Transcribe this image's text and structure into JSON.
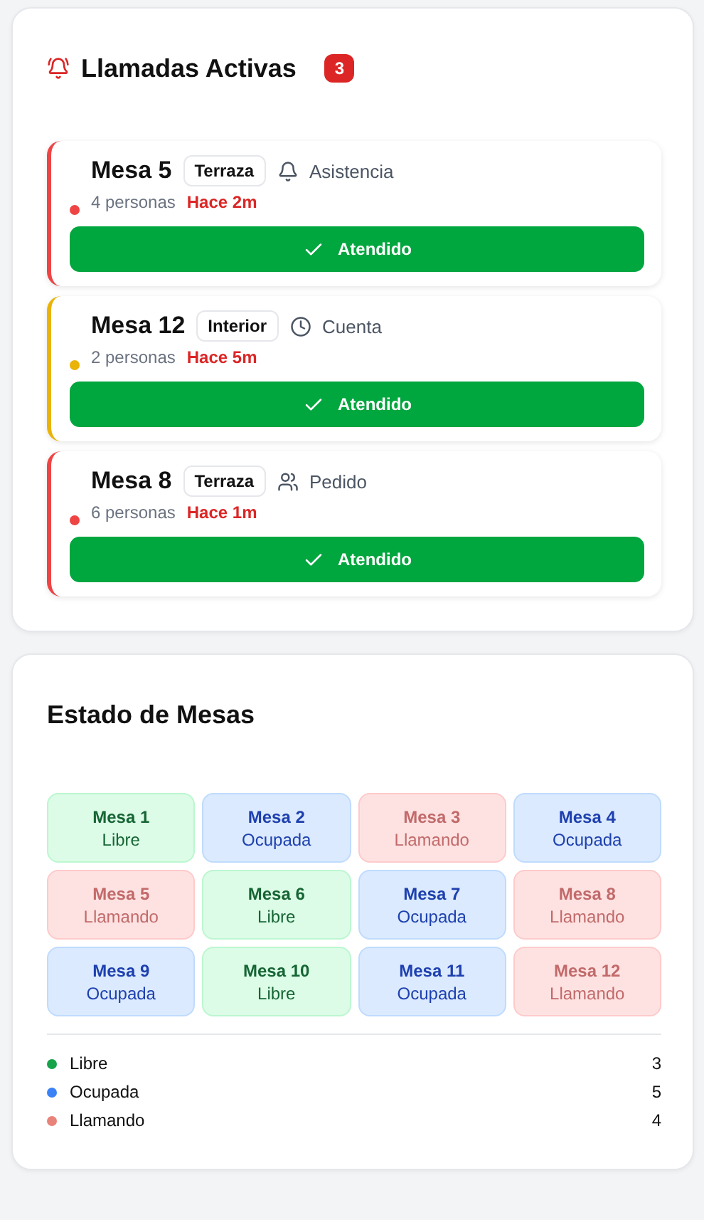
{
  "calls_panel": {
    "title": "Llamadas Activas",
    "count": "3",
    "calls": [
      {
        "table": "Mesa 5",
        "area": "Terraza",
        "kind": "assistance",
        "request": "Asistencia",
        "people": "4 personas",
        "time": "Hace 2m",
        "color": "#ef4444",
        "button": "Atendido"
      },
      {
        "table": "Mesa 12",
        "area": "Interior",
        "kind": "bill",
        "request": "Cuenta",
        "people": "2 personas",
        "time": "Hace 5m",
        "color": "#eab308",
        "button": "Atendido"
      },
      {
        "table": "Mesa 8",
        "area": "Terraza",
        "kind": "order",
        "request": "Pedido",
        "people": "6 personas",
        "time": "Hace 1m",
        "color": "#ef4444",
        "button": "Atendido"
      }
    ]
  },
  "tables_panel": {
    "title": "Estado de Mesas",
    "tables": [
      {
        "name": "Mesa 1",
        "status": "Libre",
        "kind": "free"
      },
      {
        "name": "Mesa 2",
        "status": "Ocupada",
        "kind": "busy"
      },
      {
        "name": "Mesa 3",
        "status": "Llamando",
        "kind": "calling"
      },
      {
        "name": "Mesa 4",
        "status": "Ocupada",
        "kind": "busy"
      },
      {
        "name": "Mesa 5",
        "status": "Llamando",
        "kind": "calling"
      },
      {
        "name": "Mesa 6",
        "status": "Libre",
        "kind": "free"
      },
      {
        "name": "Mesa 7",
        "status": "Ocupada",
        "kind": "busy"
      },
      {
        "name": "Mesa 8",
        "status": "Llamando",
        "kind": "calling"
      },
      {
        "name": "Mesa 9",
        "status": "Ocupada",
        "kind": "busy"
      },
      {
        "name": "Mesa 10",
        "status": "Libre",
        "kind": "free"
      },
      {
        "name": "Mesa 11",
        "status": "Ocupada",
        "kind": "busy"
      },
      {
        "name": "Mesa 12",
        "status": "Llamando",
        "kind": "calling"
      }
    ],
    "legend": [
      {
        "label": "Libre",
        "count": "3",
        "color": "#16a34a"
      },
      {
        "label": "Ocupada",
        "count": "5",
        "color": "#3b82f6"
      },
      {
        "label": "Llamando",
        "count": "4",
        "color": "#e8837a"
      }
    ]
  }
}
